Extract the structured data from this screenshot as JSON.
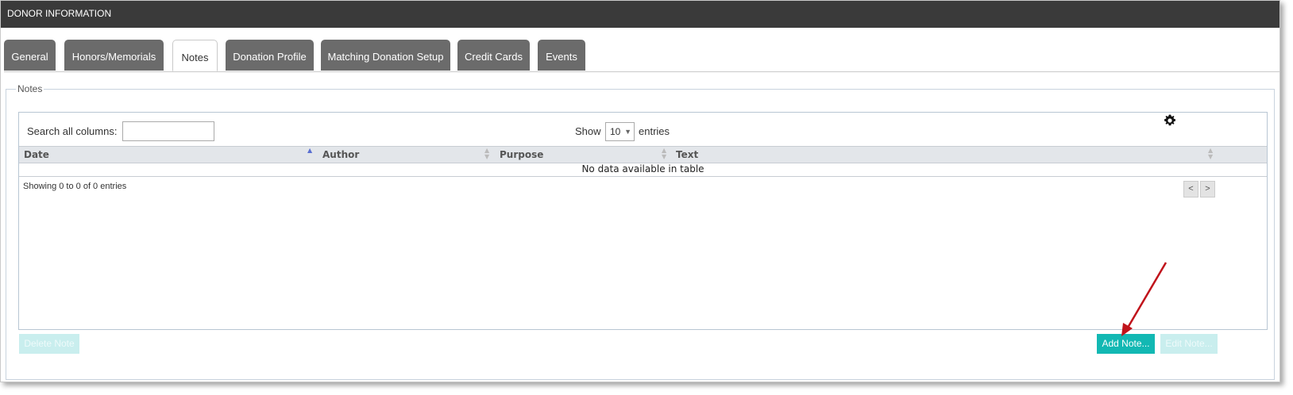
{
  "window": {
    "title": "DONOR INFORMATION"
  },
  "tabs": [
    {
      "label": "General",
      "active": false
    },
    {
      "label": "Honors/Memorials",
      "active": false
    },
    {
      "label": "Notes",
      "active": true
    },
    {
      "label": "Donation Profile",
      "active": false
    },
    {
      "label": "Matching Donation Setup",
      "active": false
    },
    {
      "label": "Credit Cards",
      "active": false
    },
    {
      "label": "Events",
      "active": false
    }
  ],
  "section": {
    "legend": "Notes"
  },
  "table": {
    "search_label": "Search all columns:",
    "search_value": "",
    "show_label": "Show",
    "page_size": "10",
    "entries_label": "entries",
    "columns": [
      "Date",
      "Author",
      "Purpose",
      "Text"
    ],
    "empty_message": "No data available in table",
    "info": "Showing 0 to 0 of 0 entries",
    "prev_label": "<",
    "next_label": ">",
    "settings_icon": "gear-icon"
  },
  "buttons": {
    "delete_note": "Delete Note",
    "add_note": "Add Note...",
    "edit_note": "Edit Note..."
  },
  "colors": {
    "titlebar": "#3a3a3a",
    "tab_inactive": "#6b6b6b",
    "primary_button": "#12b8b3",
    "annotation_arrow": "#c0131b"
  }
}
